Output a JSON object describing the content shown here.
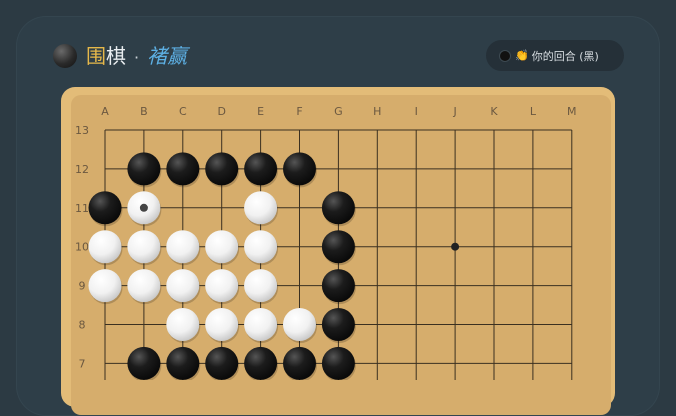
{
  "header": {
    "title_char1": "围",
    "title_char2": "棋",
    "separator": "·",
    "subtitle": "褚赢",
    "turn_emoji": "👏",
    "turn_text": "你的回合 (黑)"
  },
  "board": {
    "columns": [
      "A",
      "B",
      "C",
      "D",
      "E",
      "F",
      "G",
      "H",
      "I",
      "J",
      "K",
      "L",
      "M"
    ],
    "rows_visible": [
      "13",
      "12",
      "11",
      "10",
      "9",
      "8",
      "7"
    ],
    "size": 13,
    "star_points": [
      [
        "J",
        "10"
      ]
    ],
    "last_move": [
      "B",
      "11"
    ],
    "stones": [
      {
        "col": "B",
        "row": "12",
        "color": "black"
      },
      {
        "col": "C",
        "row": "12",
        "color": "black"
      },
      {
        "col": "D",
        "row": "12",
        "color": "black"
      },
      {
        "col": "E",
        "row": "12",
        "color": "black"
      },
      {
        "col": "F",
        "row": "12",
        "color": "black"
      },
      {
        "col": "A",
        "row": "11",
        "color": "black"
      },
      {
        "col": "B",
        "row": "11",
        "color": "white"
      },
      {
        "col": "E",
        "row": "11",
        "color": "white"
      },
      {
        "col": "G",
        "row": "11",
        "color": "black"
      },
      {
        "col": "A",
        "row": "10",
        "color": "white"
      },
      {
        "col": "B",
        "row": "10",
        "color": "white"
      },
      {
        "col": "C",
        "row": "10",
        "color": "white"
      },
      {
        "col": "D",
        "row": "10",
        "color": "white"
      },
      {
        "col": "E",
        "row": "10",
        "color": "white"
      },
      {
        "col": "G",
        "row": "10",
        "color": "black"
      },
      {
        "col": "A",
        "row": "9",
        "color": "white"
      },
      {
        "col": "B",
        "row": "9",
        "color": "white"
      },
      {
        "col": "C",
        "row": "9",
        "color": "white"
      },
      {
        "col": "D",
        "row": "9",
        "color": "white"
      },
      {
        "col": "E",
        "row": "9",
        "color": "white"
      },
      {
        "col": "G",
        "row": "9",
        "color": "black"
      },
      {
        "col": "C",
        "row": "8",
        "color": "white"
      },
      {
        "col": "D",
        "row": "8",
        "color": "white"
      },
      {
        "col": "E",
        "row": "8",
        "color": "white"
      },
      {
        "col": "F",
        "row": "8",
        "color": "white"
      },
      {
        "col": "G",
        "row": "8",
        "color": "black"
      },
      {
        "col": "B",
        "row": "7",
        "color": "black"
      },
      {
        "col": "C",
        "row": "7",
        "color": "black"
      },
      {
        "col": "D",
        "row": "7",
        "color": "black"
      },
      {
        "col": "E",
        "row": "7",
        "color": "black"
      },
      {
        "col": "F",
        "row": "7",
        "color": "black"
      },
      {
        "col": "G",
        "row": "7",
        "color": "black"
      }
    ]
  },
  "colors": {
    "line": "#3b3020",
    "label": "#6b5840",
    "star": "#222222"
  }
}
